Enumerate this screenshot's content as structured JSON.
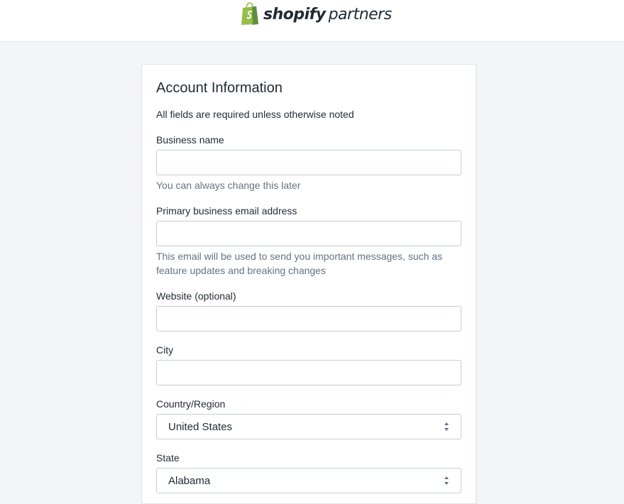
{
  "header": {
    "logo_brand": "shopify",
    "logo_sub": "partners",
    "logo_icon": "shopify-bag-icon",
    "accent_color": "#95bf47"
  },
  "form": {
    "title": "Account Information",
    "subtitle": "All fields are required unless otherwise noted",
    "business_name": {
      "label": "Business name",
      "value": "",
      "help": "You can always change this later"
    },
    "email": {
      "label": "Primary business email address",
      "value": "",
      "help": "This email will be used to send you important messages, such as feature updates and breaking changes"
    },
    "website": {
      "label": "Website (optional)",
      "value": ""
    },
    "city": {
      "label": "City",
      "value": ""
    },
    "country": {
      "label": "Country/Region",
      "selected": "United States"
    },
    "state": {
      "label": "State",
      "selected": "Alabama"
    }
  }
}
